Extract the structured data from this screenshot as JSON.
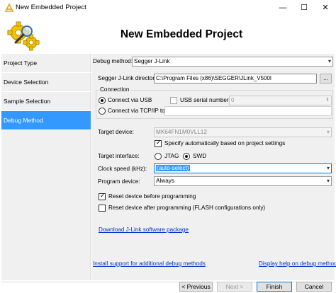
{
  "window": {
    "title": "New Embedded Project",
    "minimize_glyph": "—",
    "maximize_glyph": "☐",
    "close_glyph": "✕"
  },
  "header": {
    "heading": "New Embedded Project"
  },
  "sidebar": {
    "items": [
      {
        "label": "Project Type"
      },
      {
        "label": "Device Selection"
      },
      {
        "label": "Sample Selection"
      },
      {
        "label": "Debug Method"
      }
    ]
  },
  "form": {
    "debug_method": {
      "label": "Debug method:",
      "value": "Segger J-Link"
    },
    "jlink_dir": {
      "label": "Segger J-Link directory:",
      "value": "C:\\Program Files (x86)\\SEGGER\\JLink_V500l",
      "browse": "..."
    },
    "connection": {
      "title": "Connection",
      "usb": "Connect via USB",
      "tcp": "Connect via TCP/IP to:",
      "usb_serial_label": "USB serial number:",
      "usb_serial_value": "0"
    },
    "target_device": {
      "label": "Target device:",
      "value": "MK64FN1M0VLL12"
    },
    "specify_auto": "Specify automatically based on project settings",
    "target_interface": {
      "label": "Target interface:",
      "jtag": "JTAG",
      "swd": "SWD"
    },
    "clock_speed": {
      "label": "Clock speed (kHz):",
      "value": "(auto-select)"
    },
    "program_device": {
      "label": "Program device:",
      "value": "Always"
    },
    "reset_before": "Reset device before programming",
    "reset_after": "Reset device after programming (FLASH configurations only)",
    "download_link": "Download J-Link software package"
  },
  "links": {
    "install_support": "Install support for additional debug methods",
    "display_help": "Display help on debug methods"
  },
  "buttons": {
    "previous": "< Previous",
    "next": "Next >",
    "finish": "Finish",
    "cancel": "Cancel"
  },
  "colors": {
    "selection": "#3399ff",
    "link": "#0033cc"
  }
}
